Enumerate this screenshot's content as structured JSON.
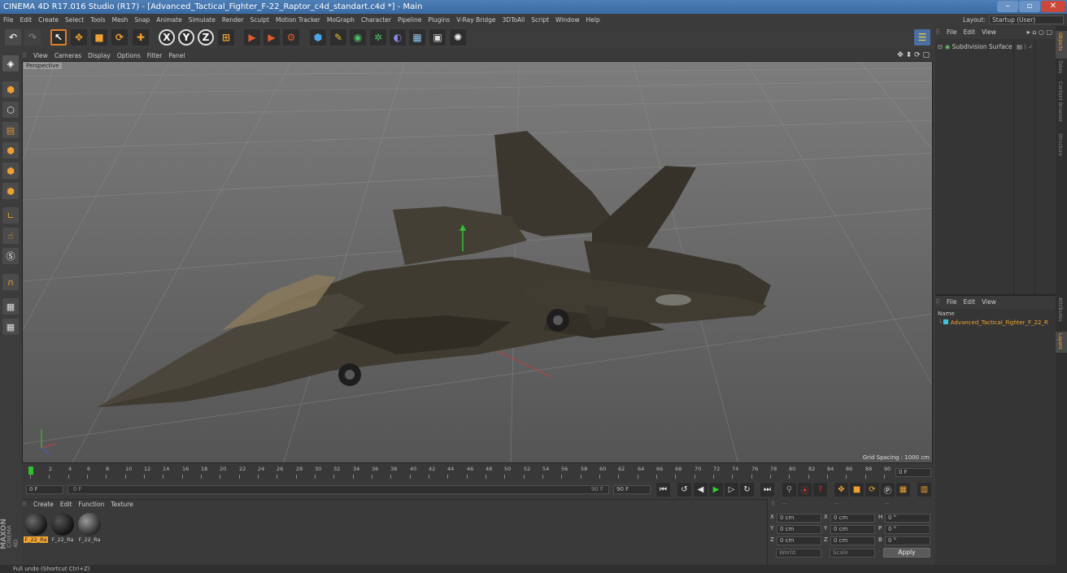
{
  "window": {
    "title": "CINEMA 4D R17.016 Studio (R17) - [Advanced_Tactical_Fighter_F-22_Raptor_c4d_standart.c4d *] - Main"
  },
  "menu": {
    "items": [
      "File",
      "Edit",
      "Create",
      "Select",
      "Tools",
      "Mesh",
      "Snap",
      "Animate",
      "Simulate",
      "Render",
      "Sculpt",
      "Motion Tracker",
      "MoGraph",
      "Character",
      "Pipeline",
      "Plugins",
      "V-Ray Bridge",
      "3DToAll",
      "Script",
      "Window",
      "Help"
    ],
    "layout_label": "Layout:",
    "layout_value": "Startup (User)"
  },
  "toolbar": {
    "axis_x": "X",
    "axis_y": "Y",
    "axis_z": "Z"
  },
  "viewport": {
    "menu": [
      "View",
      "Cameras",
      "Display",
      "Options",
      "Filter",
      "Panel"
    ],
    "view_label": "Perspective",
    "grid_spacing": "Grid Spacing : 1000 cm"
  },
  "timeline": {
    "ticks": [
      "0",
      "2",
      "4",
      "6",
      "8",
      "10",
      "12",
      "14",
      "16",
      "18",
      "20",
      "22",
      "24",
      "26",
      "28",
      "30",
      "32",
      "34",
      "36",
      "38",
      "40",
      "42",
      "44",
      "46",
      "48",
      "50",
      "52",
      "54",
      "56",
      "58",
      "60",
      "62",
      "64",
      "66",
      "68",
      "70",
      "72",
      "74",
      "76",
      "78",
      "80",
      "82",
      "84",
      "86",
      "88",
      "90"
    ],
    "current_frame": "0 F",
    "start_field": "0 F",
    "range_start": "0 F",
    "range_end": "90 F",
    "end_field": "90 F"
  },
  "materials": {
    "menu": [
      "Create",
      "Edit",
      "Function",
      "Texture"
    ],
    "items": [
      {
        "label": "F_22_Ra",
        "selected": true
      },
      {
        "label": "F_22_Ra",
        "selected": false
      },
      {
        "label": "F_22_Ra",
        "selected": false
      }
    ]
  },
  "coords": {
    "header": [
      "--",
      "--",
      "--"
    ],
    "rows": [
      {
        "axis": "X",
        "pos": "0 cm",
        "axis2": "X",
        "size": "0 cm",
        "rot_label": "H",
        "rot": "0 °"
      },
      {
        "axis": "Y",
        "pos": "0 cm",
        "axis2": "Y",
        "size": "0 cm",
        "rot_label": "P",
        "rot": "0 °"
      },
      {
        "axis": "Z",
        "pos": "0 cm",
        "axis2": "Z",
        "size": "0 cm",
        "rot_label": "B",
        "rot": "0 °"
      }
    ],
    "mode1": "World",
    "mode2": "Scale",
    "apply": "Apply"
  },
  "objects_panel": {
    "menu": [
      "File",
      "Edit",
      "View"
    ],
    "items": [
      {
        "label": "Subdivision Surface"
      }
    ]
  },
  "layers_panel": {
    "menu": [
      "File",
      "Edit",
      "View"
    ],
    "name_header": "Name",
    "items": [
      {
        "label": "Advanced_Tactical_Fighter_F_22_R"
      }
    ]
  },
  "side_tabs": [
    "Objects",
    "Takes",
    "Content Browser",
    "Structure",
    "Attributes",
    "Layers"
  ],
  "status": {
    "text": "Full undo (Shortcut Ctrl+Z)"
  },
  "logo": {
    "text1": "MAXON",
    "text2": "CINEMA 4D"
  },
  "colors": {
    "accent": "#f0a030",
    "selection": "#f4a533",
    "object_green": "#69c26a",
    "layer_cyan": "#3fc4d8"
  }
}
